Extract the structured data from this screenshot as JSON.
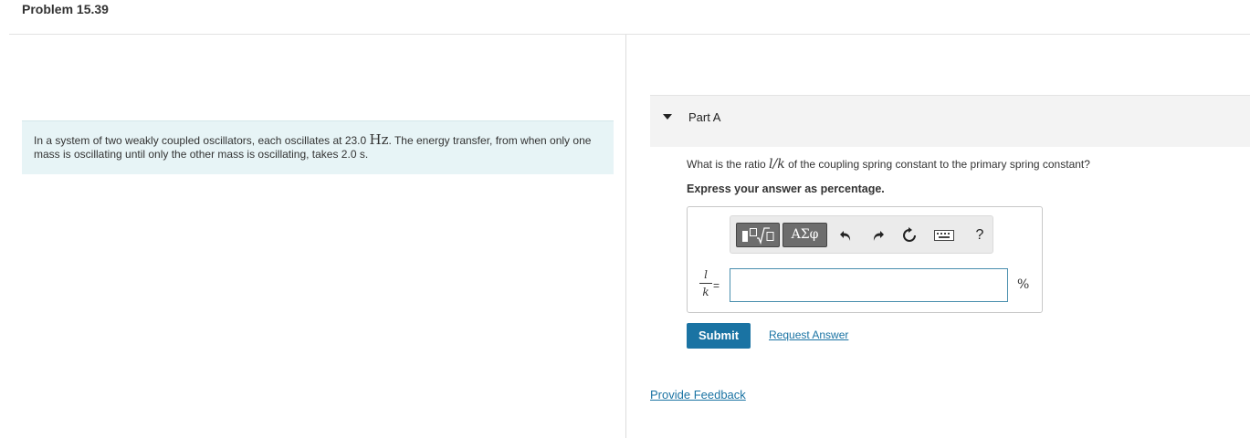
{
  "problem": {
    "title": "Problem 15.39"
  },
  "intro": {
    "text_before": "In a system of two weakly coupled oscillators, each oscillates at ",
    "value": "23.0",
    "unit": "Hz",
    "text_after": ". The energy transfer, from when only one mass is oscillating until only the other mass is oscillating, takes 2.0 s."
  },
  "part_a": {
    "title": "Part A",
    "question_before": "What is the ratio ",
    "question_math": "l/k",
    "question_after": " of the coupling spring constant to the primary spring constant?",
    "instruction": "Express your answer as percentage.",
    "fraction_numerator": "l",
    "fraction_denominator": "k",
    "equals": "=",
    "answer_value": "",
    "units": "%",
    "toolbar": {
      "symbols_label": "ΑΣφ",
      "help_label": "?",
      "icons": [
        "templates-icon",
        "symbols-icon",
        "undo-icon",
        "redo-icon",
        "reset-icon",
        "keyboard-icon",
        "help-icon"
      ]
    },
    "submit_label": "Submit",
    "request_answer_label": "Request Answer"
  },
  "feedback": {
    "label": "Provide Feedback"
  },
  "colors": {
    "accent": "#1a73a3",
    "intro_bg": "#e7f4f6",
    "part_header_bg": "#f3f3f3",
    "toolbar_button": "#6d6d6d"
  }
}
